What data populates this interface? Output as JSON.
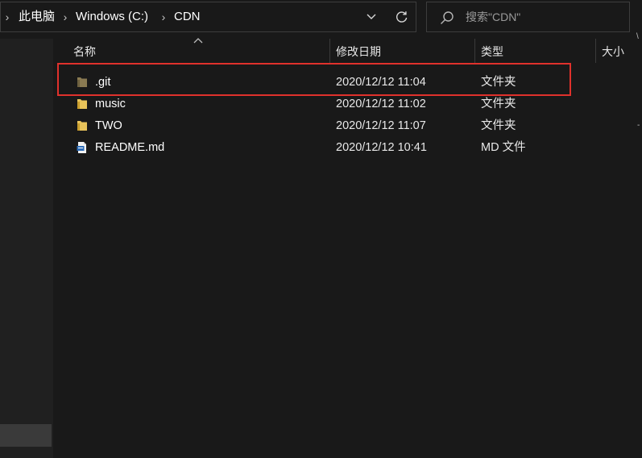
{
  "address_bar": {
    "breadcrumbs": [
      {
        "label": "此电脑"
      },
      {
        "label": "Windows (C:)"
      },
      {
        "label": "CDN"
      }
    ]
  },
  "search": {
    "placeholder": "搜索\"CDN\""
  },
  "columns": {
    "name": "名称",
    "date_modified": "修改日期",
    "type": "类型",
    "size": "大小"
  },
  "files": [
    {
      "name": ".git",
      "date": "2020/12/12 11:04",
      "type": "文件夹",
      "icon": "folder-hidden-icon"
    },
    {
      "name": "music",
      "date": "2020/12/12 11:02",
      "type": "文件夹",
      "icon": "folder-icon"
    },
    {
      "name": "TWO",
      "date": "2020/12/12 11:07",
      "type": "文件夹",
      "icon": "folder-icon"
    },
    {
      "name": "README.md",
      "date": "2020/12/12 10:41",
      "type": "MD 文件",
      "icon": "md-file-icon"
    }
  ],
  "colors": {
    "background": "#191919",
    "highlight_border": "#e0312c",
    "folder": "#e8c35a",
    "hidden_folder": "#8a7a52"
  }
}
